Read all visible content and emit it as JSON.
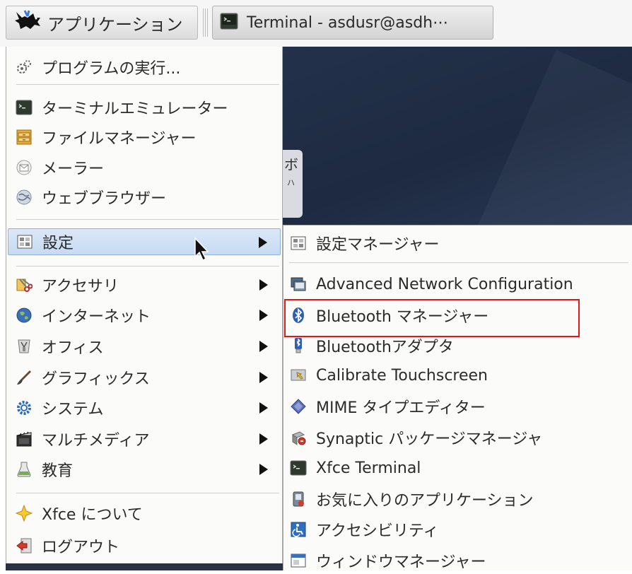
{
  "panel": {
    "app_menu_label": "アプリケーション",
    "task_label": "Terminal - asdusr@asdh⋯"
  },
  "desktop": {
    "partial_text_1": "ボ",
    "partial_text_2": "ハ"
  },
  "menu": {
    "items": [
      {
        "label": "プログラムの実行...",
        "icon": "run-program-icon"
      },
      {
        "label": "ターミナルエミュレーター",
        "icon": "terminal-icon"
      },
      {
        "label": "ファイルマネージャー",
        "icon": "file-manager-icon"
      },
      {
        "label": "メーラー",
        "icon": "mail-icon"
      },
      {
        "label": "ウェブブラウザー",
        "icon": "web-browser-icon"
      },
      {
        "label": "設定",
        "icon": "settings-icon",
        "submenu": true,
        "active": true
      },
      {
        "label": "アクセサリ",
        "icon": "accessories-icon",
        "submenu": true
      },
      {
        "label": "インターネット",
        "icon": "internet-icon",
        "submenu": true
      },
      {
        "label": "オフィス",
        "icon": "office-icon",
        "submenu": true
      },
      {
        "label": "グラフィックス",
        "icon": "graphics-icon",
        "submenu": true
      },
      {
        "label": "システム",
        "icon": "system-icon",
        "submenu": true
      },
      {
        "label": "マルチメディア",
        "icon": "multimedia-icon",
        "submenu": true
      },
      {
        "label": "教育",
        "icon": "education-icon",
        "submenu": true
      },
      {
        "label": "Xfce について",
        "icon": "about-xfce-icon"
      },
      {
        "label": "ログアウト",
        "icon": "logout-icon"
      }
    ]
  },
  "submenu": {
    "items": [
      {
        "label": "設定マネージャー",
        "icon": "settings-manager-icon"
      },
      {
        "label": "Advanced Network Configuration",
        "icon": "network-config-icon"
      },
      {
        "label": "Bluetooth マネージャー",
        "icon": "bluetooth-icon",
        "highlighted": true
      },
      {
        "label": "Bluetoothアダプタ",
        "icon": "bluetooth-adapter-icon"
      },
      {
        "label": "Calibrate Touchscreen",
        "icon": "touchscreen-icon"
      },
      {
        "label": "MIME タイプエディター",
        "icon": "mime-editor-icon"
      },
      {
        "label": "Synaptic パッケージマネージャ",
        "icon": "synaptic-icon"
      },
      {
        "label": "Xfce Terminal",
        "icon": "xfce-terminal-icon"
      },
      {
        "label": "お気に入りのアプリケーション",
        "icon": "favorites-icon"
      },
      {
        "label": "アクセシビリティ",
        "icon": "accessibility-icon"
      },
      {
        "label": "ウィンドウマネージャー",
        "icon": "window-manager-icon"
      }
    ]
  },
  "colors": {
    "highlight_border": "#e01818",
    "active_item_bg": "#c7daf2",
    "desktop_bg": "#1d2a41"
  }
}
